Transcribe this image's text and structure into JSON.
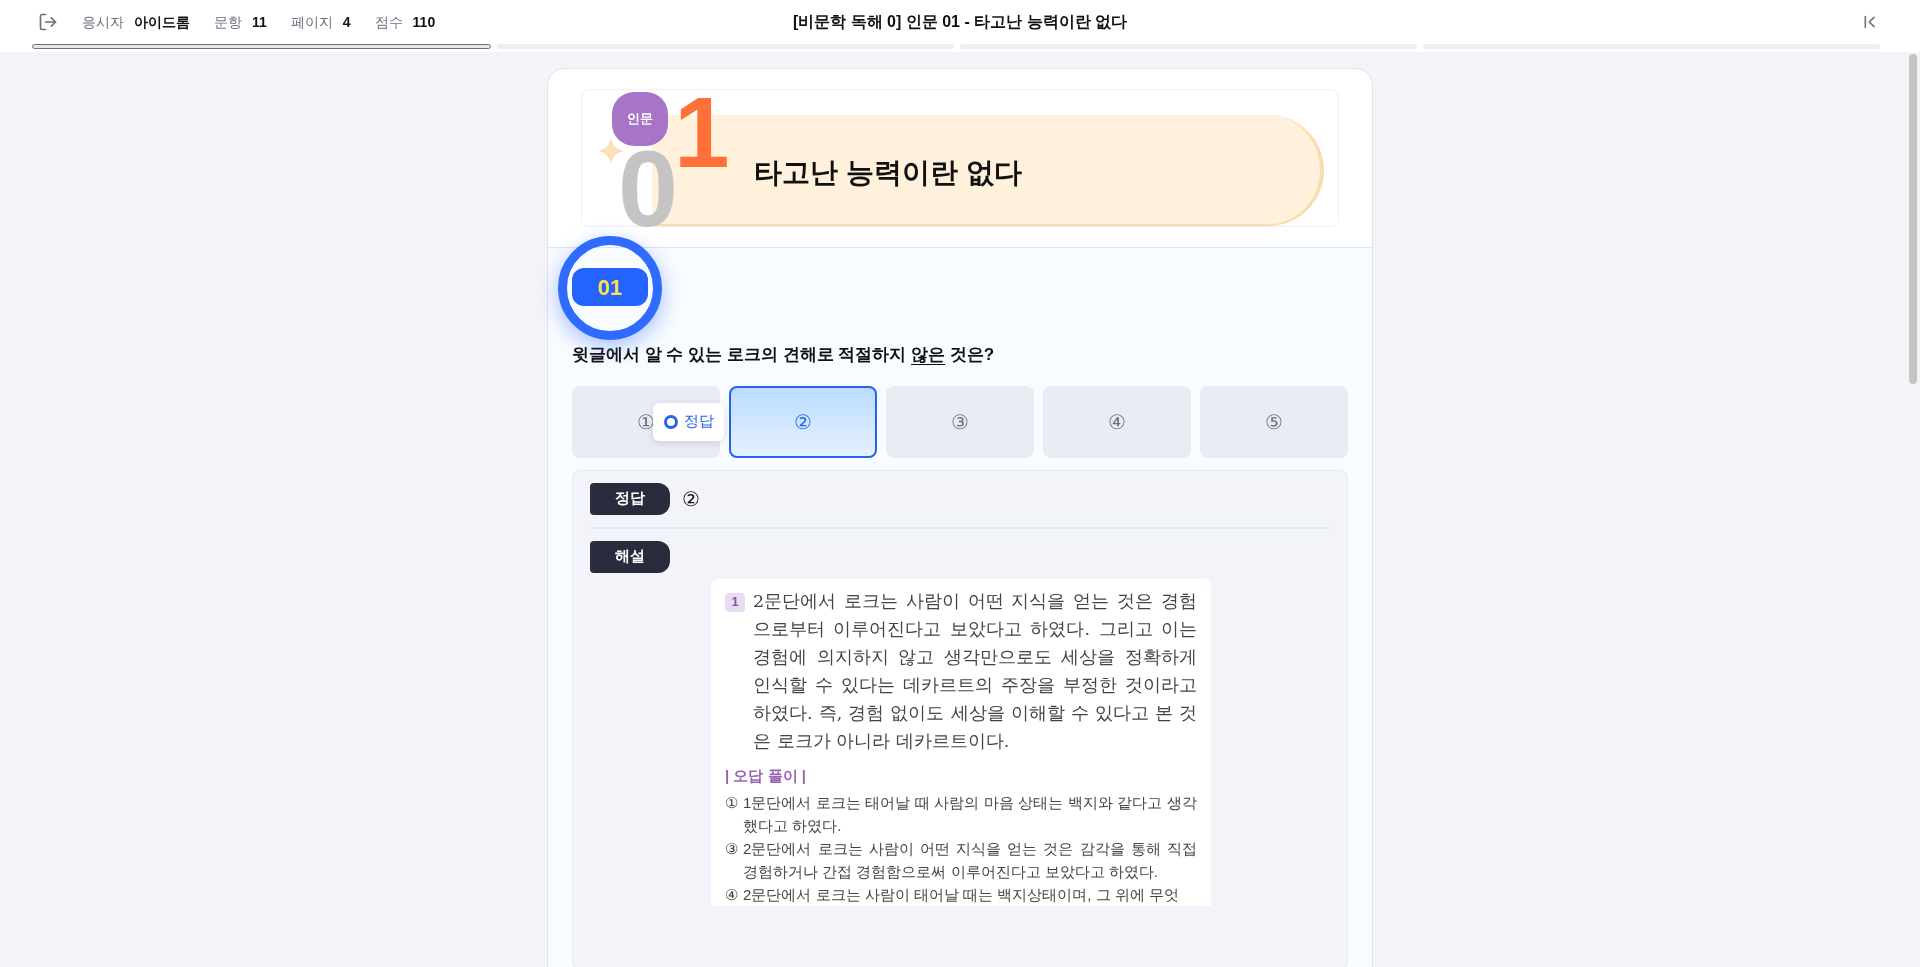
{
  "top_bar": {
    "stats": [
      {
        "label": "응시자",
        "value": "아이드롬"
      },
      {
        "label": "문항",
        "value": "11"
      },
      {
        "label": "페이지",
        "value": "4"
      },
      {
        "label": "점수",
        "value": "110"
      }
    ],
    "title": "[비문학 독해 0] 인문 01 - 타고난 능력이란 없다"
  },
  "progress_segments": [
    {
      "selected": true
    },
    {
      "selected": false
    },
    {
      "selected": false
    },
    {
      "selected": false
    }
  ],
  "banner": {
    "category": "인문",
    "digits": [
      "0",
      "1"
    ],
    "title": "타고난 능력이란 없다"
  },
  "question": {
    "number": "01",
    "parts": [
      {
        "text": "윗글에서 알 수 있는 로크의 견해로 적절하지 ",
        "underlined": false
      },
      {
        "text": "않은",
        "underlined": true
      },
      {
        "text": " 것은?",
        "underlined": false
      }
    ]
  },
  "choices": [
    {
      "label": "①",
      "selected": false
    },
    {
      "label": "②",
      "selected": true
    },
    {
      "label": "③",
      "selected": false
    },
    {
      "label": "④",
      "selected": false
    },
    {
      "label": "⑤",
      "selected": false
    }
  ],
  "tooltip": {
    "label": "정답"
  },
  "answer": {
    "label": "정답",
    "value": "②"
  },
  "explanation": {
    "label": "해설",
    "badge": "1",
    "paragraph": "2문단에서 로크는 사람이 어떤 지식을 얻는 것은 경험으로부터 이루어진다고 보았다고 하였다. 그리고 이는 경험에 의지하지 않고 생각만으로도 세상을 정확하게 인식할 수 있다는 데카르트의 주장을 부정한 것이라고 하였다. 즉, 경험 없이도 세상을 이해할 수 있다고 본 것은 로크가 아니라 데카르트이다.",
    "wrong_heading": "| 오답 풀이 |",
    "items": [
      {
        "marker": "①",
        "text": "1문단에서 로크는 태어날 때 사람의 마음 상태는 백지와 같다고 생각했다고 하였다."
      },
      {
        "marker": "③",
        "text": "2문단에서 로크는 사람이 어떤 지식을 얻는 것은 감각을 통해 직접 경험하거나 간접 경험함으로써 이루어진다고 보았다고 하였다."
      },
      {
        "marker": "④",
        "text": "2문단에서 로크는 사람이 태어날 때는 백지상태이며, 그 위에 무엇"
      }
    ]
  }
}
